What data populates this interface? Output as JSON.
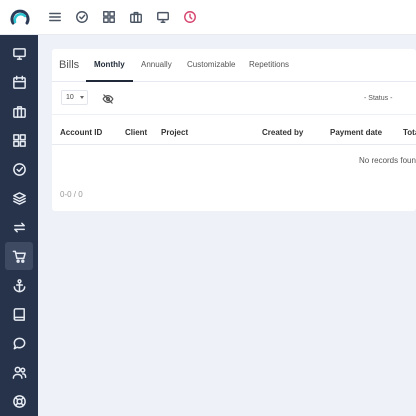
{
  "topbar": {
    "icons": [
      "menu-icon",
      "check-circle-icon",
      "grid-icon",
      "briefcase-icon",
      "monitor-icon",
      "clock-icon"
    ],
    "clock_color": "#d6456e"
  },
  "sidebar": {
    "items": [
      "monitor-icon",
      "calendar-icon",
      "briefcase-icon",
      "grid-icon",
      "check-circle-icon",
      "layers-icon",
      "repeat-icon",
      "cart-icon",
      "anchor-icon",
      "book-icon",
      "chat-icon",
      "users-icon",
      "lifebuoy-icon"
    ],
    "active": "cart-icon"
  },
  "bills": {
    "title": "Bills",
    "tabs": [
      {
        "label": "Monthly",
        "active": true
      },
      {
        "label": "Annually",
        "active": false
      },
      {
        "label": "Customizable",
        "active": false
      },
      {
        "label": "Repetitions",
        "active": false
      }
    ],
    "page_size": "10",
    "status_placeholder": "- Status -",
    "columns": [
      "Account ID",
      "Client",
      "Project",
      "Created by",
      "Payment date",
      "Tota"
    ],
    "empty_message": "No records foun",
    "pager_info": "0-0 / 0"
  },
  "colors": {
    "sidebar_bg": "#27334a",
    "page_bg": "#eef2f8",
    "accent_active_tab": "#1f2937"
  }
}
